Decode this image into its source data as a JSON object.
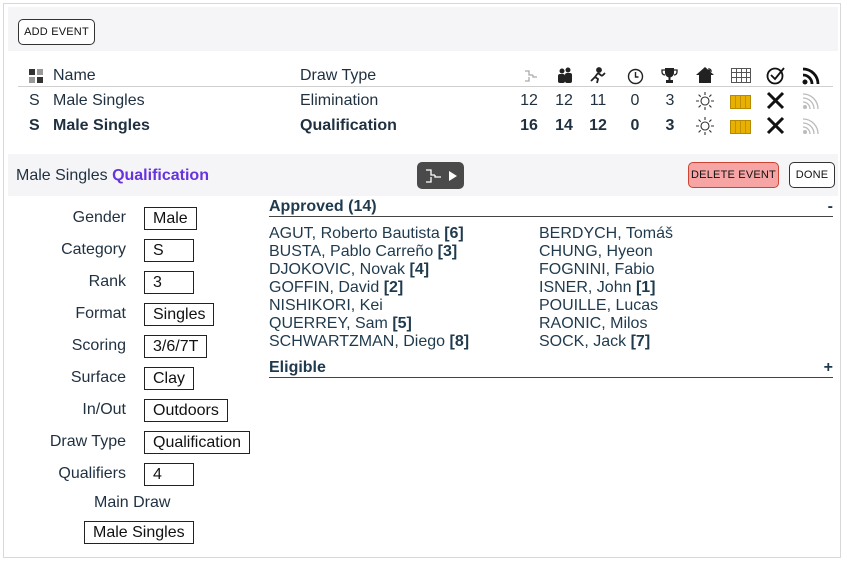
{
  "toolbar": {
    "add_event_label": "ADD EVENT"
  },
  "events_table": {
    "headers": {
      "name": "Name",
      "draw_type": "Draw Type"
    },
    "icons": [
      "draw-size-icon",
      "players-icon",
      "tennis-player-icon",
      "clock-icon",
      "trophy-icon",
      "home-icon",
      "schedule-grid-icon",
      "check-circle-icon",
      "rss-feed-icon"
    ],
    "rows": [
      {
        "category": "S",
        "name": "Male Singles",
        "draw_type": "Elimination",
        "counts": [
          "12",
          "12",
          "11",
          "0",
          "3"
        ],
        "selected": false
      },
      {
        "category": "S",
        "name": "Male Singles",
        "draw_type": "Qualification",
        "counts": [
          "16",
          "14",
          "12",
          "0",
          "3"
        ],
        "selected": true
      }
    ]
  },
  "event_bar": {
    "title": "Male Singles",
    "title_accent": "Qualification",
    "delete_label": "DELETE EVENT",
    "done_label": "DONE"
  },
  "attributes": {
    "gender": {
      "label": "Gender",
      "value": "Male"
    },
    "category": {
      "label": "Category",
      "value": "S"
    },
    "rank": {
      "label": "Rank",
      "value": "3"
    },
    "format": {
      "label": "Format",
      "value": "Singles"
    },
    "scoring": {
      "label": "Scoring",
      "value": "3/6/7T"
    },
    "surface": {
      "label": "Surface",
      "value": "Clay"
    },
    "inout": {
      "label": "In/Out",
      "value": "Outdoors"
    },
    "draw_type": {
      "label": "Draw Type",
      "value": "Qualification"
    },
    "qualifiers": {
      "label": "Qualifiers",
      "value": "4"
    },
    "main_draw": {
      "label": "Main Draw",
      "value": "Male Singles"
    }
  },
  "approved": {
    "title": "Approved (14)",
    "toggle": "-",
    "left": [
      {
        "name": "AGUT, Roberto Bautista",
        "seed": "[6]"
      },
      {
        "name": "BUSTA, Pablo Carreño",
        "seed": "[3]"
      },
      {
        "name": "DJOKOVIC, Novak",
        "seed": "[4]"
      },
      {
        "name": "GOFFIN, David",
        "seed": "[2]"
      },
      {
        "name": "NISHIKORI, Kei",
        "seed": ""
      },
      {
        "name": "QUERREY, Sam",
        "seed": "[5]"
      },
      {
        "name": "SCHWARTZMAN, Diego",
        "seed": "[8]"
      }
    ],
    "right": [
      {
        "name": "BERDYCH, Tomáš",
        "seed": ""
      },
      {
        "name": "CHUNG, Hyeon",
        "seed": ""
      },
      {
        "name": "FOGNINI, Fabio",
        "seed": ""
      },
      {
        "name": "ISNER, John",
        "seed": "[1]"
      },
      {
        "name": "POUILLE, Lucas",
        "seed": ""
      },
      {
        "name": "RAONIC, Milos",
        "seed": ""
      },
      {
        "name": "SOCK, Jack",
        "seed": "[7]"
      }
    ]
  },
  "eligible": {
    "title": "Eligible",
    "toggle": "+"
  }
}
